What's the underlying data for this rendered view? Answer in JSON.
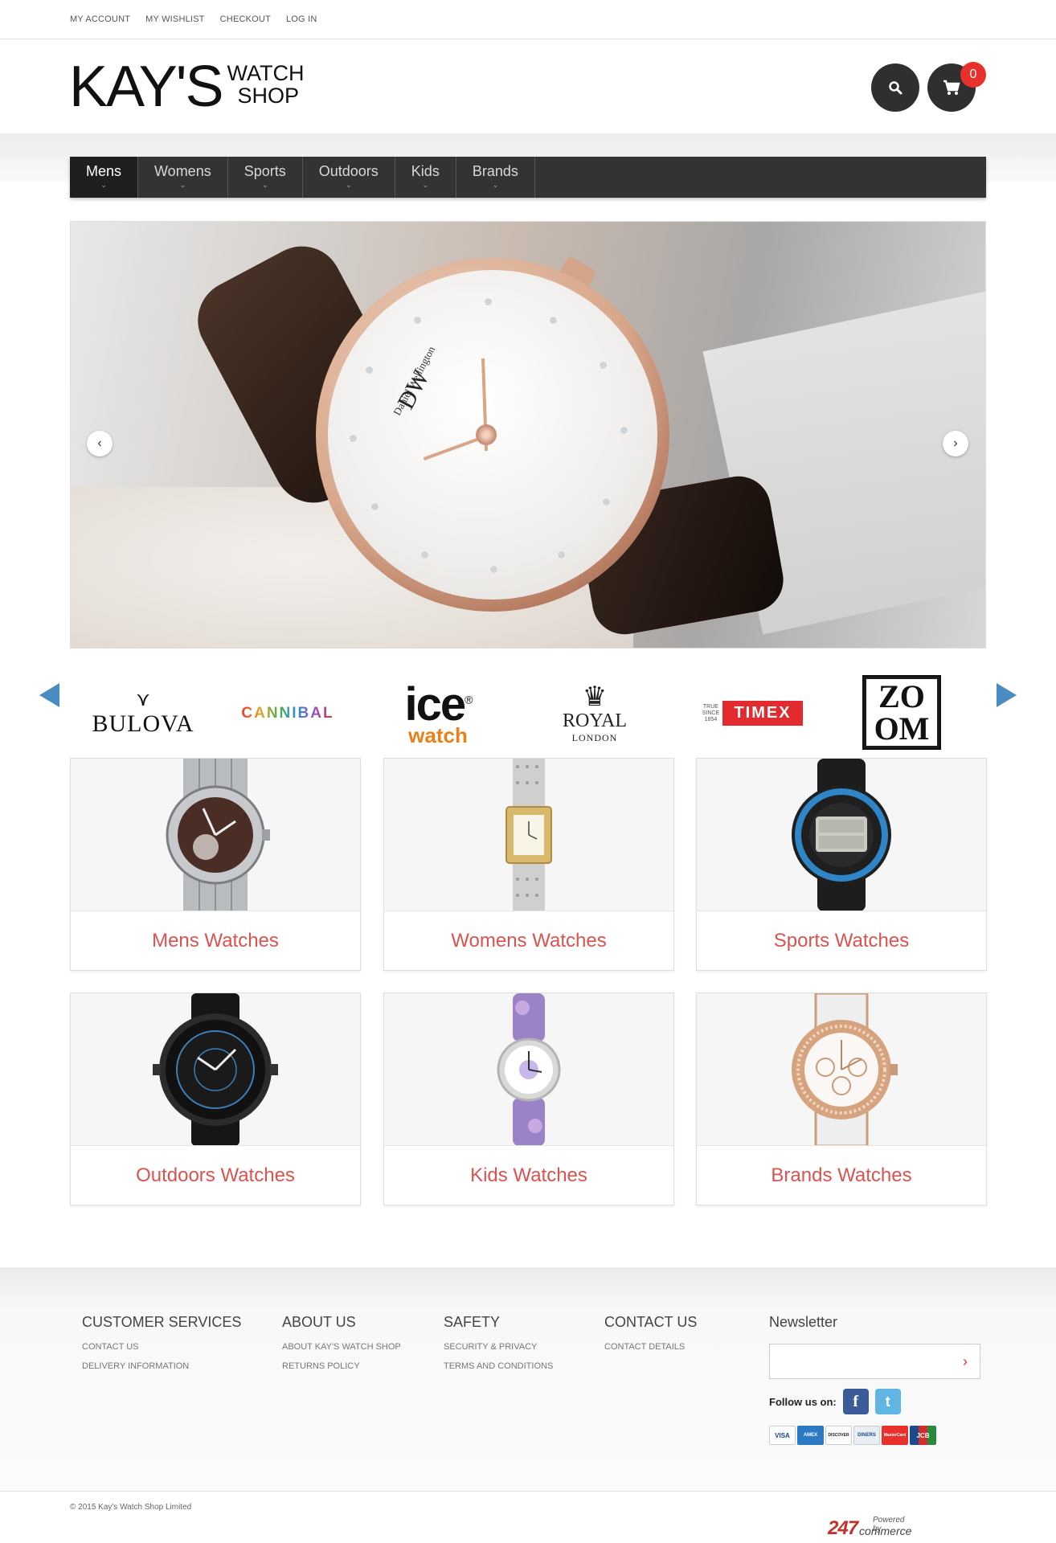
{
  "topbar": {
    "links": [
      "MY ACCOUNT",
      "MY WISHLIST",
      "CHECKOUT",
      "LOG IN"
    ]
  },
  "header": {
    "logo_main": "KAY'S",
    "logo_sub_1": "WATCH",
    "logo_sub_2": "SHOP",
    "search_icon": "search-icon",
    "cart_icon": "cart-icon",
    "cart_count": "0"
  },
  "nav": {
    "items": [
      {
        "label": "Mens",
        "active": true
      },
      {
        "label": "Womens",
        "active": false
      },
      {
        "label": "Sports",
        "active": false
      },
      {
        "label": "Outdoors",
        "active": false
      },
      {
        "label": "Kids",
        "active": false
      },
      {
        "label": "Brands",
        "active": false
      }
    ],
    "chevron_glyph": "⌄"
  },
  "hero": {
    "watch_brand_text": "Daniel Wellington",
    "watch_monogram": "DW",
    "prev_glyph": "‹",
    "next_glyph": "›"
  },
  "brands": {
    "bulova": "BULOVA",
    "cannibal": "CANNIBAL",
    "ice_1": "ice",
    "ice_2": "watch",
    "ice_mark": "®",
    "royal_1": "ROYAL",
    "royal_2": "LONDON",
    "timex_since": "TRUE SINCE 1854",
    "timex": "TIMEX",
    "zoom_1": "ZO",
    "zoom_2": "OM"
  },
  "categories": [
    {
      "title": "Mens Watches"
    },
    {
      "title": "Womens Watches"
    },
    {
      "title": "Sports Watches"
    },
    {
      "title": "Outdoors Watches"
    },
    {
      "title": "Kids Watches"
    },
    {
      "title": "Brands Watches"
    }
  ],
  "footer": {
    "customer_services": {
      "heading": "CUSTOMER SERVICES",
      "links": [
        "CONTACT US",
        "DELIVERY INFORMATION"
      ]
    },
    "about_us": {
      "heading": "ABOUT US",
      "links": [
        "ABOUT KAY'S WATCH SHOP",
        "RETURNS POLICY"
      ]
    },
    "safety": {
      "heading": "SAFETY",
      "links": [
        "SECURITY & PRIVACY",
        "TERMS AND CONDITIONS"
      ]
    },
    "contact_us": {
      "heading": "CONTACT US",
      "links": [
        "CONTACT DETAILS"
      ]
    },
    "newsletter": {
      "heading": "Newsletter",
      "input_value": "",
      "submit_glyph": "›",
      "follow_label": "Follow us on:",
      "facebook_glyph": "f",
      "twitter_glyph": "t"
    },
    "payment_cards": [
      "VISA",
      "AMEX",
      "DISCOVER",
      "DINERS",
      "MasterCard",
      "JCB"
    ]
  },
  "bottom": {
    "copyright": "© 2015 Kay's Watch Shop Limited",
    "powered_small": "Powered by",
    "powered_big": "247",
    "powered_com": "commerce"
  },
  "colors": {
    "accent_red": "#e8302c",
    "category_title": "#d9534f",
    "nav_bg": "#333333",
    "brand_arrow": "#4a8cc2"
  }
}
